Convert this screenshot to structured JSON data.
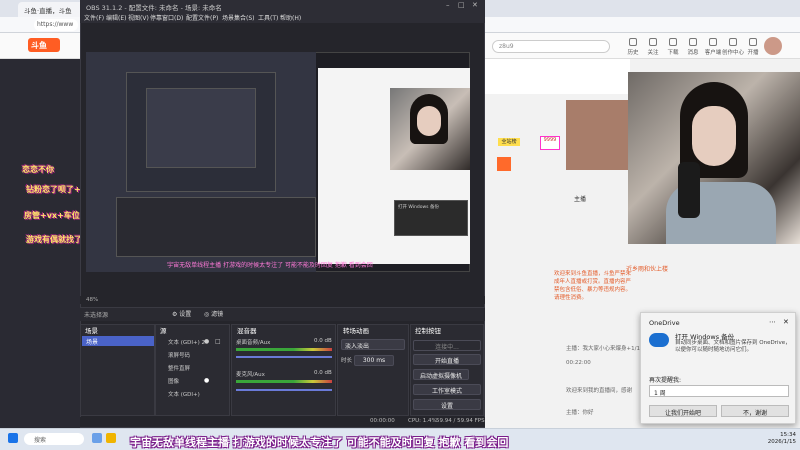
{
  "browser": {
    "tab1_title": "斗鱼·直播，斗鱼",
    "address": "https://www",
    "site_search": "z8u9",
    "nav": [
      "历史",
      "关注",
      "下载",
      "消息",
      "客户端",
      "创作中心",
      "开播"
    ]
  },
  "obs": {
    "title": "OBS 31.1.2 - 配置文件: 未命名 - 场景: 未命名",
    "menu": [
      "文件(F)",
      "编辑(E)",
      "视图(V)",
      "停靠窗口(D)",
      "配置文件(P)",
      "场景集合(S)",
      "工具(T)",
      "帮助(H)"
    ],
    "zoom": "48%",
    "source_name": "未选择源",
    "toolbar": {
      "settings": "设置",
      "filters": "滤镜"
    },
    "docks": {
      "scenes": "场景",
      "sources": "源",
      "mixer": "混音器",
      "transitions": "转场动画",
      "controls": "控制按钮"
    },
    "scene_item": "场景",
    "sources_list": [
      "文本 (GDI+) 2",
      "滚屏号码",
      "整件直屏",
      "图像",
      "文本 (GDI+)"
    ],
    "mixer": [
      {
        "name": "桌面音频/Aux",
        "db": "0.0 dB"
      },
      {
        "name": "麦克风/Aux",
        "db": "0.0 dB"
      }
    ],
    "transition": {
      "type": "淡入淡出",
      "duration_label": "时长",
      "duration": "300 ms"
    },
    "controls": [
      "开始直播",
      "开始录制",
      "启动虚拟摄像机",
      "工作室模式",
      "设置"
    ],
    "controls_placeholder": "连接中...",
    "status": {
      "time1": "00:00:00",
      "time2": "00:00:00",
      "cpu": "CPU: 1.4%",
      "fps": "59.94 / 59.94 FPS"
    },
    "subtitle": "宇宙无敌单线程主播 打游戏的时候太专注了 可能不能及时回复 抱歉 看到会回"
  },
  "danmu": [
    "恋恋不你",
    "钻粉恋了呗了+钻粉群",
    "房管+vx+车位",
    "游戏有偶就找了我以上"
  ],
  "right_page": {
    "gift_bar_label": "全站榜",
    "host_label": "主播",
    "notice": "欢迎来到斗鱼直播，斗鱼严禁未成年人直播或打赏。直播内容严禁包含低俗、暴力等违规内容。请理性消费。",
    "chat": [
      "主播：我大家小心来爆身+1/1+1",
      "00:22:00",
      "欢迎来到我的直播间，感谢",
      "主播：你好"
    ],
    "host_name": "近乡雨和伙上楼",
    "cnt": "9999"
  },
  "onedrive": {
    "app": "OneDrive",
    "title": "打开 Windows 备份",
    "body": "自动同步桌面、文档和图片保存到 OneDrive，以便你可以随时随地访问它们。",
    "remind_label": "再次提醒我:",
    "remind_value": "1 周",
    "primary": "让我们开始吧",
    "secondary": "不，谢谢"
  },
  "taskbar": {
    "search": "搜索",
    "ticker": "宇宙无敌单线程主播 打游戏的时候太专注了 可能不能及时回复 抱歉 看到会回",
    "time": "15:34",
    "date": "2026/1/15"
  }
}
